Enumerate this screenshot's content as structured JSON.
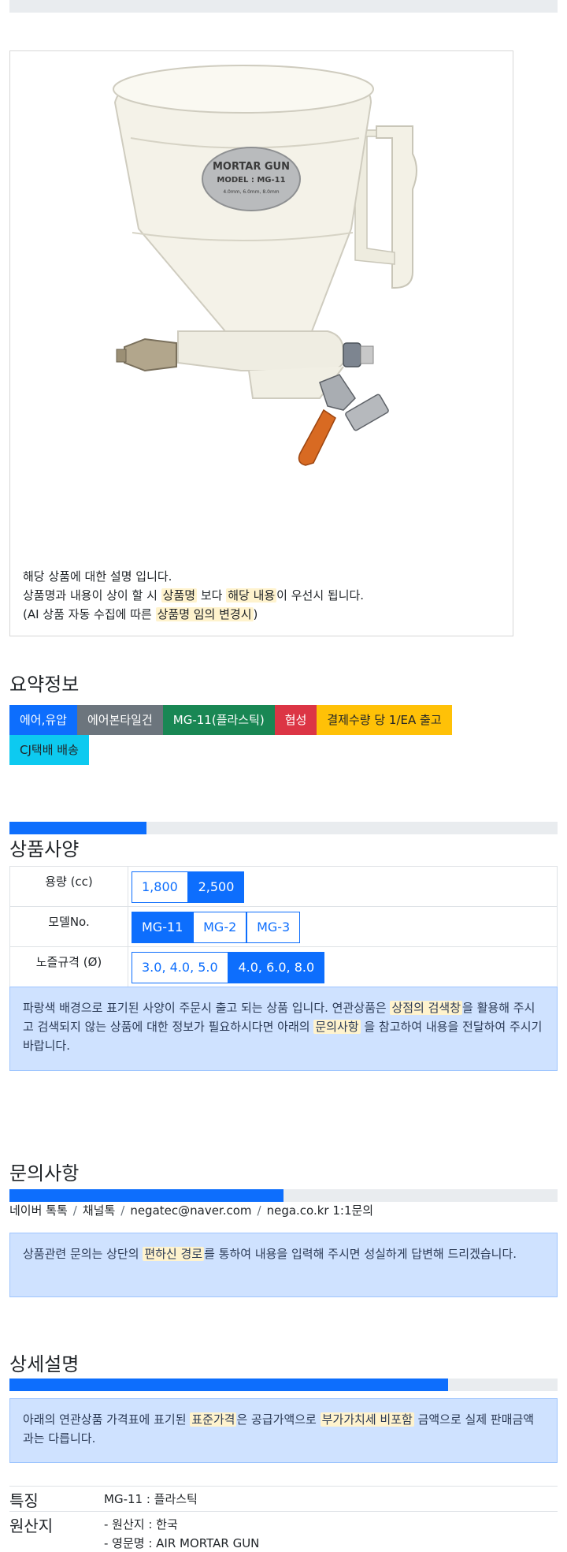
{
  "product": {
    "image_label_1": "MORTAR GUN",
    "image_label_2": "MODEL : MG-11",
    "image_label_3": "4.0mm, 6.0mm, 8.0mm",
    "desc_line1": "해당 상품에 대한 설명 입니다.",
    "desc_line2_a": "상품명과 내용이 상이 할 시 ",
    "desc_line2_hl1": "상품명",
    "desc_line2_b": " 보다 ",
    "desc_line2_hl2": "해당 내용",
    "desc_line2_c": "이 우선시 됩니다.",
    "desc_line3_a": "(AI 상품 자동 수집에 따른 ",
    "desc_line3_hl": "상품명 임의 변경시",
    "desc_line3_b": ")"
  },
  "summary": {
    "title": "요약정보",
    "badges": [
      "에어,유압",
      "에어본타일건",
      "MG-11(플라스틱)",
      "협성",
      "결제수량 당 1/EA 출고",
      "CJ택배 배송"
    ]
  },
  "specs": {
    "title": "상품사양",
    "progress_percent": 25,
    "rows": [
      {
        "label": "용량 (cc)",
        "options": [
          "1,800",
          "2,500"
        ],
        "selected": "2,500"
      },
      {
        "label": "모델No.",
        "options": [
          "MG-11",
          "MG-2",
          "MG-3"
        ],
        "selected": "MG-11"
      },
      {
        "label": "노즐규격 (Ø)",
        "options": [
          "3.0, 4.0, 5.0",
          "4.0, 6.0, 8.0"
        ],
        "selected": "4.0, 6.0, 8.0"
      }
    ],
    "notice_a": "파랑색 배경으로 표기된 사양이 주문시 출고 되는 상품 입니다. 연관상품은 ",
    "notice_hl1": "상점의 검색창",
    "notice_b": "을 활용해 주시고 검색되지 않는 상품에 대한 정보가 필요하시다면 아래의 ",
    "notice_hl2": "문의사항",
    "notice_c": " 을 참고하여 내용을 전달하여 주시기 바랍니다."
  },
  "inquiry": {
    "title": "문의사항",
    "progress_percent": 50,
    "channels": [
      "네이버 톡톡",
      "채널톡",
      "negatec@naver.com",
      "nega.co.kr 1:1문의"
    ],
    "separator": "/",
    "notice_a": "상품관련 문의는 상단의 ",
    "notice_hl": "편하신 경로",
    "notice_b": "를 통하여 내용을 입력해 주시면 성실하게 답변해 드리겠습니다."
  },
  "detail": {
    "title": "상세설명",
    "progress_percent": 80,
    "notice_a": "아래의 연관상품 가격표에 표기된 ",
    "notice_hl1": "표준가격",
    "notice_b": "은 공급가액으로 ",
    "notice_hl2": "부가가치세 비포함",
    "notice_c": " 금액으로 실제 판매금액과는 다릅니다.",
    "features": [
      {
        "label": "특징",
        "values": [
          "MG-11 : 플라스틱"
        ]
      },
      {
        "label": "원산지",
        "values": [
          "- 원산지 : 한국",
          "- 영문명 : AIR MORTAR GUN"
        ]
      }
    ]
  },
  "colors": {
    "primary": "#0d6efd",
    "secondary": "#6c757d",
    "success": "#198754",
    "danger": "#dc3545",
    "warning": "#ffc107",
    "info": "#0dcaf0",
    "alert_bg": "#cfe2ff",
    "highlight_bg": "#fff3cd"
  }
}
